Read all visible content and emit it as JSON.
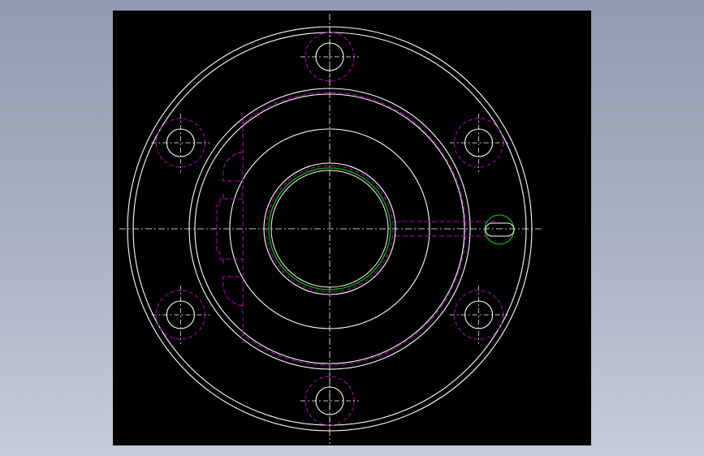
{
  "viewport": {
    "background": "#000000"
  },
  "colors": {
    "geometry": "#ffffff",
    "hidden_lines": "#c000c0",
    "green_feature": "#00c000",
    "centerline": "#ffffff",
    "window_gradient_top": "#8e9bb0",
    "window_gradient_bottom": "#c5ccd7"
  },
  "drawing": {
    "view": "front-view",
    "bolt_hole_count": 6,
    "feature": "flange-with-bore-and-side-port"
  }
}
